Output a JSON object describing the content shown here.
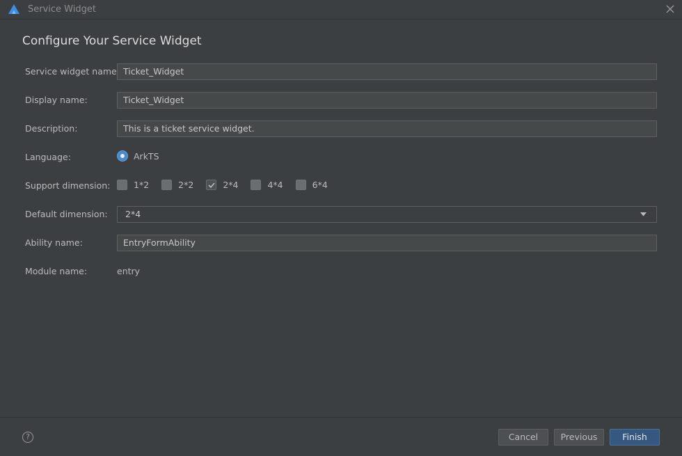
{
  "window": {
    "title": "Service Widget",
    "logo_icon": "harmony-logo-icon",
    "close_icon": "close-icon"
  },
  "page": {
    "title": "Configure Your Service Widget"
  },
  "form": {
    "widget_name": {
      "label": "Service widget name:",
      "value": "Ticket_Widget"
    },
    "display_name": {
      "label": "Display name:",
      "value": "Ticket_Widget"
    },
    "description": {
      "label": "Description:",
      "value": "This is a ticket service widget."
    },
    "language": {
      "label": "Language:",
      "option": "ArkTS",
      "selected": true
    },
    "support_dimension": {
      "label": "Support dimension:",
      "options": [
        {
          "label": "1*2",
          "checked": false
        },
        {
          "label": "2*2",
          "checked": false
        },
        {
          "label": "2*4",
          "checked": true
        },
        {
          "label": "4*4",
          "checked": false
        },
        {
          "label": "6*4",
          "checked": false
        }
      ]
    },
    "default_dimension": {
      "label": "Default dimension:",
      "value": "2*4"
    },
    "ability_name": {
      "label": "Ability name:",
      "value": "EntryFormAbility"
    },
    "module_name": {
      "label": "Module name:",
      "value": "entry"
    }
  },
  "footer": {
    "help_icon": "help-icon",
    "help_glyph": "?",
    "cancel_label": "Cancel",
    "previous_label": "Previous",
    "finish_label": "Finish"
  },
  "colors": {
    "background": "#3c3f41",
    "field_bg": "#45494a",
    "accent": "#4a88c7",
    "primary_button": "#365880"
  }
}
